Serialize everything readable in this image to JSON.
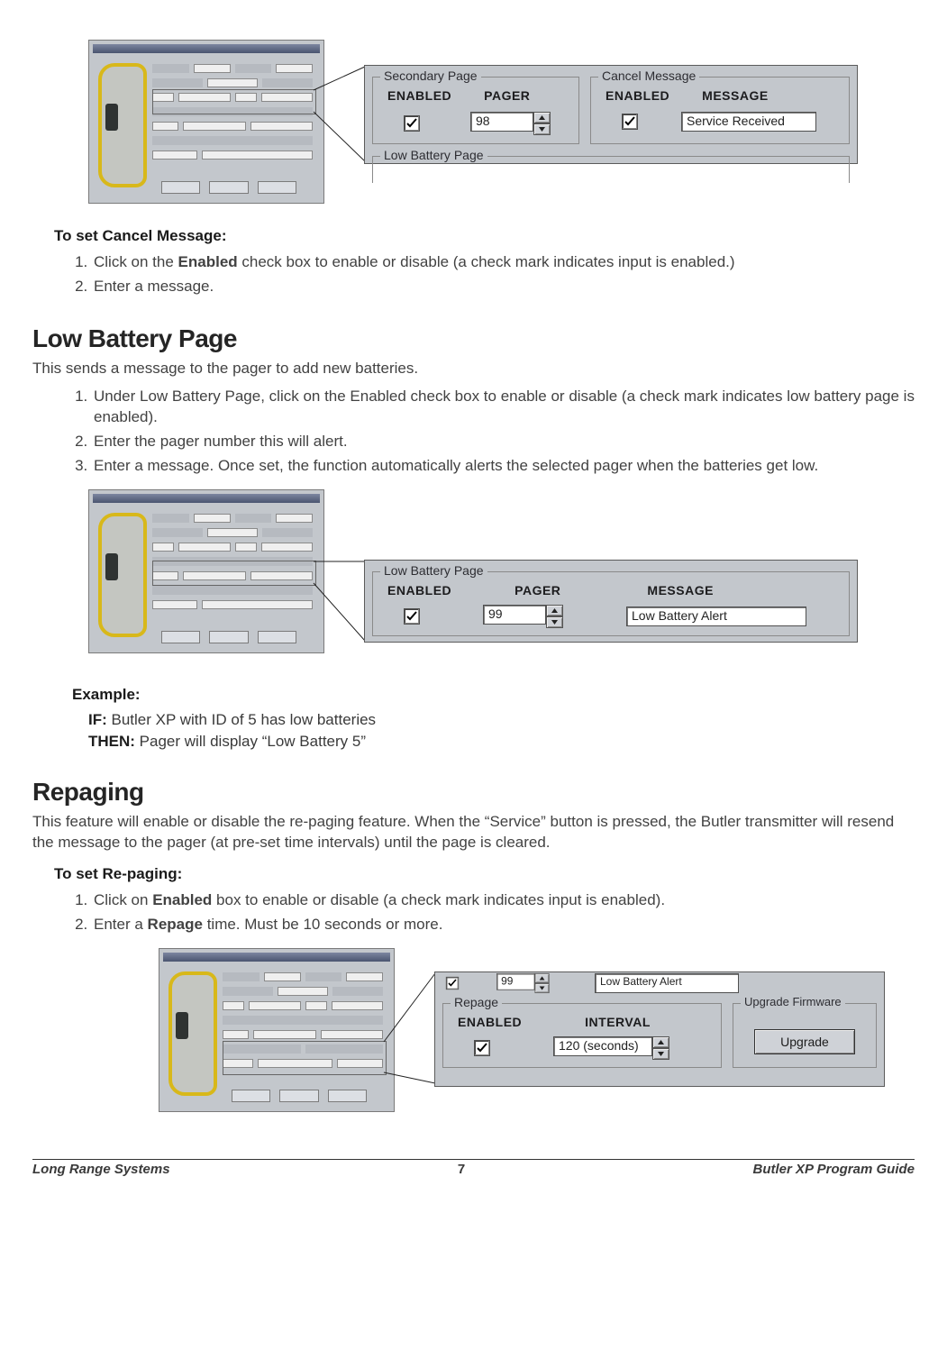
{
  "section_cancel": {
    "heading": "To set Cancel Message:",
    "step1_pre": "Click on the ",
    "step1_bold": "Enabled",
    "step1_post": " check box to enable or disable (a check mark indicates input is enabled.)",
    "step2": "Enter a message."
  },
  "figure_secondary_cancel": {
    "secondary": {
      "group_label": "Secondary Page",
      "header_enabled": "ENABLED",
      "header_pager": "PAGER",
      "pager_value": "98"
    },
    "cancel": {
      "group_label": "Cancel Message",
      "header_enabled": "ENABLED",
      "header_message": "MESSAGE",
      "message_value": "Service Received"
    },
    "cutoff_label": "Low Battery Page"
  },
  "section_lowbat": {
    "title": "Low Battery Page",
    "intro": "This sends a message to the pager to add new batteries.",
    "step1": "Under Low Battery Page, click on the Enabled check box to enable or disable (a check mark indicates low battery page is enabled).",
    "step2": "Enter the pager number this will alert.",
    "step3": "Enter a message. Once set, the function automatically alerts the selected pager when the batteries get low."
  },
  "figure_lowbat": {
    "group_label": "Low Battery Page",
    "header_enabled": "ENABLED",
    "header_pager": "PAGER",
    "header_message": "MESSAGE",
    "pager_value": "99",
    "message_value": "Low Battery Alert"
  },
  "example": {
    "heading": "Example:",
    "if_label": "IF:",
    "if_text": " Butler XP with ID of 5 has low batteries",
    "then_label": "THEN:",
    "then_text": " Pager will display “Low Battery 5”"
  },
  "section_repaging": {
    "title": "Repaging",
    "intro": "This feature will enable or disable the re-paging feature. When the “Service” button is pressed, the Butler transmitter will resend the message to the pager (at pre-set time intervals) until the page is cleared.",
    "heading": "To set Re-paging:",
    "step1_pre": "Click on ",
    "step1_bold": "Enabled",
    "step1_post": " box to enable or disable (a check mark indicates input is enabled).",
    "step2_pre": "Enter a ",
    "step2_bold": "Repage",
    "step2_post": " time. Must be 10 seconds or more."
  },
  "figure_repage": {
    "top_strip_value": "99",
    "top_strip_msg": "Low Battery Alert",
    "repage": {
      "group_label": "Repage",
      "header_enabled": "ENABLED",
      "header_interval": "INTERVAL",
      "interval_value": "120 (seconds)"
    },
    "upgrade": {
      "group_label": "Upgrade Firmware",
      "button_label": "Upgrade"
    }
  },
  "footer": {
    "left": "Long Range Systems",
    "center": "7",
    "right": "Butler XP Program Guide"
  }
}
